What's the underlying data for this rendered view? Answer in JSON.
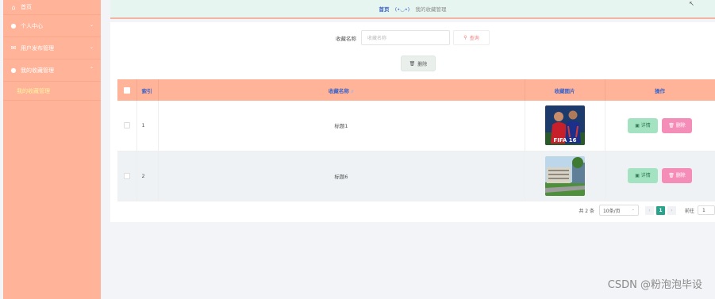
{
  "sidebar": {
    "home": {
      "label": "首页",
      "icon": "home-icon"
    },
    "items": [
      {
        "label": "个人中心",
        "icon": "user-icon"
      },
      {
        "label": "用户发布管理",
        "icon": "mail-icon"
      },
      {
        "label": "我的收藏管理",
        "icon": "user-icon"
      }
    ],
    "subitems": [
      {
        "label": "我的收藏管理"
      }
    ]
  },
  "breadcrumb": {
    "home": "首页",
    "separator": "(•◡•)",
    "current": "我的收藏管理"
  },
  "search": {
    "label": "收藏名称",
    "placeholder": "收藏名称",
    "button": "查询"
  },
  "toolbar": {
    "delete_label": "删除"
  },
  "table": {
    "headers": {
      "index": "索引",
      "name": "收藏名称",
      "image": "收藏图片",
      "actions": "操作"
    },
    "rows": [
      {
        "index": "1",
        "name": "标题1",
        "image_desc": "FIFA 16 cover",
        "image_text": "FIFA 16"
      },
      {
        "index": "2",
        "name": "标题6",
        "image_desc": "campus building photo"
      }
    ],
    "detail_label": "详情",
    "delete_label": "删除"
  },
  "pagination": {
    "total": "共 2 条",
    "page_size": "10条/页",
    "current_page": "1",
    "goto_label": "前往",
    "goto_value": "1"
  },
  "watermark": "CSDN @粉泡泡毕设",
  "colors": {
    "sidebar_bg": "#ffb398",
    "header_bg": "#ffb398",
    "accent_blue": "#3b63c9",
    "detail_btn": "#a4e3c1",
    "delete_btn": "#f58db9",
    "page_active": "#2aa38c"
  }
}
